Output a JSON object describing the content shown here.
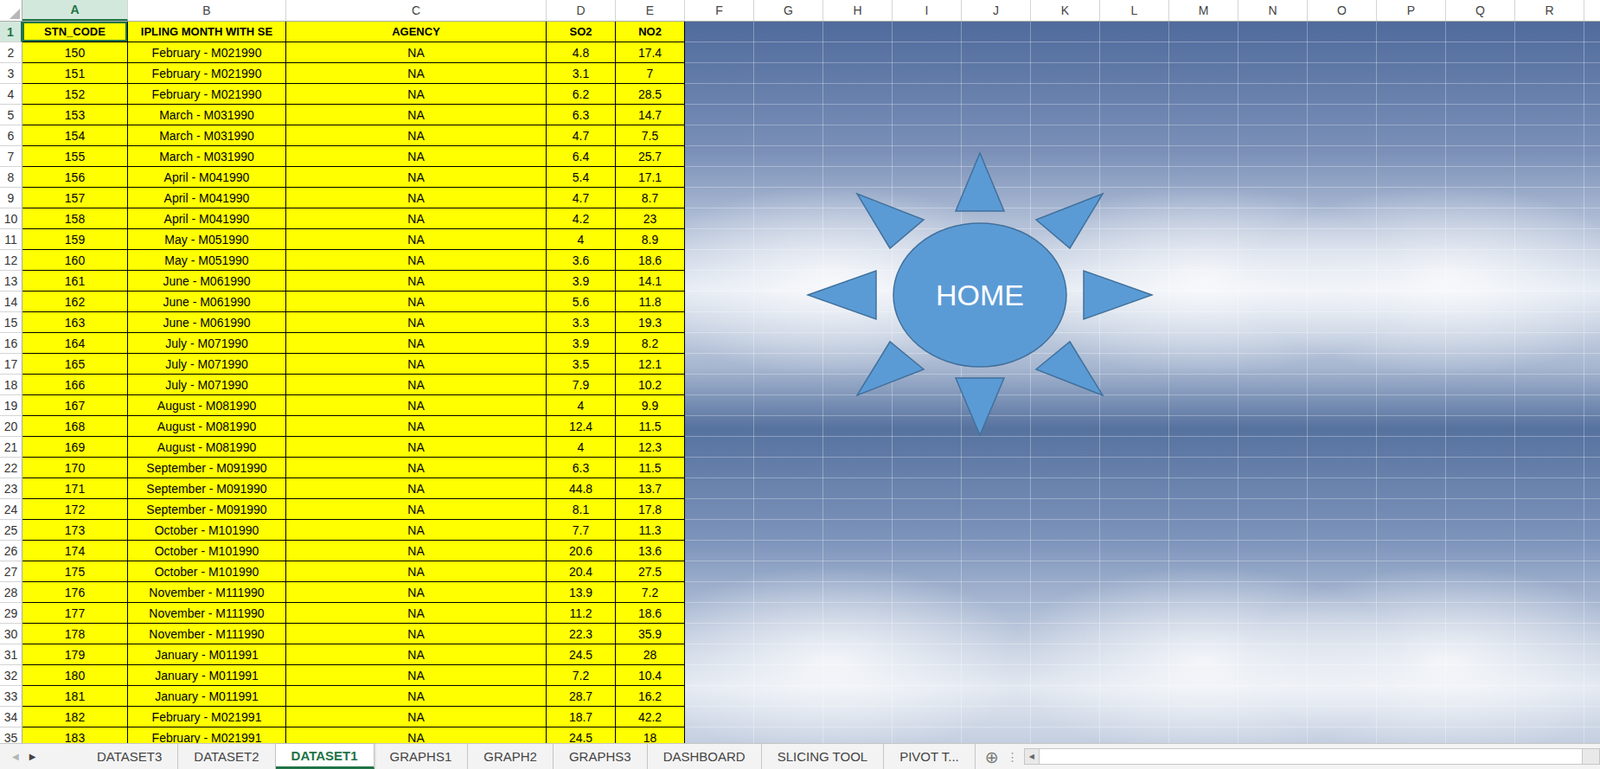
{
  "sheet": {
    "columns": [
      {
        "label": "A",
        "selected": true
      },
      {
        "label": "B",
        "selected": false
      },
      {
        "label": "C",
        "selected": false
      },
      {
        "label": "D",
        "selected": false
      },
      {
        "label": "E",
        "selected": false
      },
      {
        "label": "F",
        "selected": false
      },
      {
        "label": "G",
        "selected": false
      },
      {
        "label": "H",
        "selected": false
      },
      {
        "label": "I",
        "selected": false
      },
      {
        "label": "J",
        "selected": false
      },
      {
        "label": "K",
        "selected": false
      },
      {
        "label": "L",
        "selected": false
      },
      {
        "label": "M",
        "selected": false
      },
      {
        "label": "N",
        "selected": false
      },
      {
        "label": "O",
        "selected": false
      },
      {
        "label": "P",
        "selected": false
      },
      {
        "label": "Q",
        "selected": false
      },
      {
        "label": "R",
        "selected": false
      }
    ],
    "active_cell": {
      "column": "A",
      "row": "1"
    },
    "rows": [
      {
        "number": "1",
        "selected": true,
        "kind": "header",
        "cells": [
          "STN_CODE",
          "IPLING MONTH WITH SE",
          "AGENCY",
          "SO2",
          "NO2"
        ]
      },
      {
        "number": "2",
        "selected": false,
        "kind": "data",
        "cells": [
          "150",
          "February - M021990",
          "NA",
          "4.8",
          "17.4"
        ]
      },
      {
        "number": "3",
        "selected": false,
        "kind": "data",
        "cells": [
          "151",
          "February - M021990",
          "NA",
          "3.1",
          "7"
        ]
      },
      {
        "number": "4",
        "selected": false,
        "kind": "data",
        "cells": [
          "152",
          "February - M021990",
          "NA",
          "6.2",
          "28.5"
        ]
      },
      {
        "number": "5",
        "selected": false,
        "kind": "data",
        "cells": [
          "153",
          "March - M031990",
          "NA",
          "6.3",
          "14.7"
        ]
      },
      {
        "number": "6",
        "selected": false,
        "kind": "data",
        "cells": [
          "154",
          "March - M031990",
          "NA",
          "4.7",
          "7.5"
        ]
      },
      {
        "number": "7",
        "selected": false,
        "kind": "data",
        "cells": [
          "155",
          "March - M031990",
          "NA",
          "6.4",
          "25.7"
        ]
      },
      {
        "number": "8",
        "selected": false,
        "kind": "data",
        "cells": [
          "156",
          "April - M041990",
          "NA",
          "5.4",
          "17.1"
        ]
      },
      {
        "number": "9",
        "selected": false,
        "kind": "data",
        "cells": [
          "157",
          "April - M041990",
          "NA",
          "4.7",
          "8.7"
        ]
      },
      {
        "number": "10",
        "selected": false,
        "kind": "data",
        "cells": [
          "158",
          "April - M041990",
          "NA",
          "4.2",
          "23"
        ]
      },
      {
        "number": "11",
        "selected": false,
        "kind": "data",
        "cells": [
          "159",
          "May - M051990",
          "NA",
          "4",
          "8.9"
        ]
      },
      {
        "number": "12",
        "selected": false,
        "kind": "data",
        "cells": [
          "160",
          "May - M051990",
          "NA",
          "3.6",
          "18.6"
        ]
      },
      {
        "number": "13",
        "selected": false,
        "kind": "data",
        "cells": [
          "161",
          "June - M061990",
          "NA",
          "3.9",
          "14.1"
        ]
      },
      {
        "number": "14",
        "selected": false,
        "kind": "data",
        "cells": [
          "162",
          "June - M061990",
          "NA",
          "5.6",
          "11.8"
        ]
      },
      {
        "number": "15",
        "selected": false,
        "kind": "data",
        "cells": [
          "163",
          "June - M061990",
          "NA",
          "3.3",
          "19.3"
        ]
      },
      {
        "number": "16",
        "selected": false,
        "kind": "data",
        "cells": [
          "164",
          "July - M071990",
          "NA",
          "3.9",
          "8.2"
        ]
      },
      {
        "number": "17",
        "selected": false,
        "kind": "data",
        "cells": [
          "165",
          "July - M071990",
          "NA",
          "3.5",
          "12.1"
        ]
      },
      {
        "number": "18",
        "selected": false,
        "kind": "data",
        "cells": [
          "166",
          "July - M071990",
          "NA",
          "7.9",
          "10.2"
        ]
      },
      {
        "number": "19",
        "selected": false,
        "kind": "data",
        "cells": [
          "167",
          "August - M081990",
          "NA",
          "4",
          "9.9"
        ]
      },
      {
        "number": "20",
        "selected": false,
        "kind": "data",
        "cells": [
          "168",
          "August - M081990",
          "NA",
          "12.4",
          "11.5"
        ]
      },
      {
        "number": "21",
        "selected": false,
        "kind": "data",
        "cells": [
          "169",
          "August - M081990",
          "NA",
          "4",
          "12.3"
        ]
      },
      {
        "number": "22",
        "selected": false,
        "kind": "data",
        "cells": [
          "170",
          "September - M091990",
          "NA",
          "6.3",
          "11.5"
        ]
      },
      {
        "number": "23",
        "selected": false,
        "kind": "data",
        "cells": [
          "171",
          "September - M091990",
          "NA",
          "44.8",
          "13.7"
        ]
      },
      {
        "number": "24",
        "selected": false,
        "kind": "data",
        "cells": [
          "172",
          "September - M091990",
          "NA",
          "8.1",
          "17.8"
        ]
      },
      {
        "number": "25",
        "selected": false,
        "kind": "data",
        "cells": [
          "173",
          "October - M101990",
          "NA",
          "7.7",
          "11.3"
        ]
      },
      {
        "number": "26",
        "selected": false,
        "kind": "data",
        "cells": [
          "174",
          "October - M101990",
          "NA",
          "20.6",
          "13.6"
        ]
      },
      {
        "number": "27",
        "selected": false,
        "kind": "data",
        "cells": [
          "175",
          "October - M101990",
          "NA",
          "20.4",
          "27.5"
        ]
      },
      {
        "number": "28",
        "selected": false,
        "kind": "data",
        "cells": [
          "176",
          "November - M111990",
          "NA",
          "13.9",
          "7.2"
        ]
      },
      {
        "number": "29",
        "selected": false,
        "kind": "data",
        "cells": [
          "177",
          "November - M111990",
          "NA",
          "11.2",
          "18.6"
        ]
      },
      {
        "number": "30",
        "selected": false,
        "kind": "data",
        "cells": [
          "178",
          "November - M111990",
          "NA",
          "22.3",
          "35.9"
        ]
      },
      {
        "number": "31",
        "selected": false,
        "kind": "data",
        "cells": [
          "179",
          "January - M011991",
          "NA",
          "24.5",
          "28"
        ]
      },
      {
        "number": "32",
        "selected": false,
        "kind": "data",
        "cells": [
          "180",
          "January - M011991",
          "NA",
          "7.2",
          "10.4"
        ]
      },
      {
        "number": "33",
        "selected": false,
        "kind": "data",
        "cells": [
          "181",
          "January - M011991",
          "NA",
          "28.7",
          "16.2"
        ]
      },
      {
        "number": "34",
        "selected": false,
        "kind": "data",
        "cells": [
          "182",
          "February - M021991",
          "NA",
          "18.7",
          "42.2"
        ]
      },
      {
        "number": "35",
        "selected": false,
        "kind": "data",
        "cells": [
          "183",
          "February - M021991",
          "NA",
          "24.5",
          "18"
        ]
      }
    ]
  },
  "shape": {
    "text": "HOME"
  },
  "sheet_tabs": {
    "nav": [
      {
        "glyph": "◀",
        "disabled": true
      },
      {
        "glyph": "▶",
        "disabled": false
      }
    ],
    "tabs": [
      {
        "label": "DATASET3",
        "selected": false
      },
      {
        "label": "DATASET2",
        "selected": false
      },
      {
        "label": "DATASET1",
        "selected": true
      },
      {
        "label": "GRAPHS1",
        "selected": false
      },
      {
        "label": "GRAPH2",
        "selected": false
      },
      {
        "label": "GRAPHS3",
        "selected": false
      },
      {
        "label": "DASHBOARD",
        "selected": false
      },
      {
        "label": "SLICING TOOL",
        "selected": false
      },
      {
        "label": "PIVOT T...",
        "selected": false
      }
    ],
    "add": "⊕",
    "more": "⋮"
  },
  "scrollbar": {
    "arrow": "◀",
    "level": 0.97
  }
}
